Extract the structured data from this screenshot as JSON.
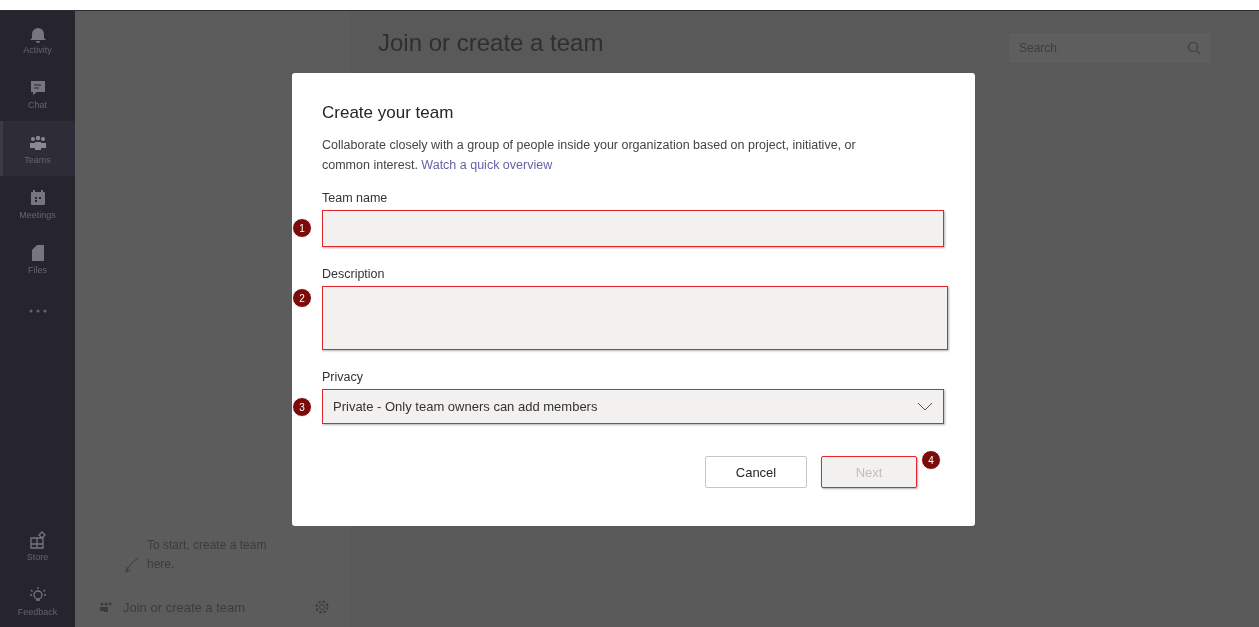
{
  "rail": {
    "items": [
      {
        "label": "Activity",
        "selected": false
      },
      {
        "label": "Chat",
        "selected": false
      },
      {
        "label": "Teams",
        "selected": true
      },
      {
        "label": "Meetings",
        "selected": false
      },
      {
        "label": "Files",
        "selected": false
      }
    ],
    "bottom_items": [
      {
        "label": "Store"
      },
      {
        "label": "Feedback"
      }
    ]
  },
  "teams_panel": {
    "hint": "To start, create a team here.",
    "join_label": "Join or create a team"
  },
  "main": {
    "title": "Join or create a team",
    "search": {
      "placeholder": "Search"
    }
  },
  "dialog": {
    "title": "Create your team",
    "description": "Collaborate closely with a group of people inside your organization based on project, initiative, or common interest.",
    "link": "Watch a quick overview",
    "fields": [
      {
        "kind": "text",
        "label": "Team name",
        "marker": "1"
      },
      {
        "kind": "textarea",
        "label": "Description",
        "marker": "2"
      },
      {
        "kind": "select",
        "label": "Privacy",
        "value": "Private - Only team owners can add members",
        "marker": "3"
      }
    ],
    "buttons": [
      {
        "label": "Cancel",
        "disabled": false
      },
      {
        "label": "Next",
        "disabled": true,
        "marker": "4"
      }
    ]
  }
}
